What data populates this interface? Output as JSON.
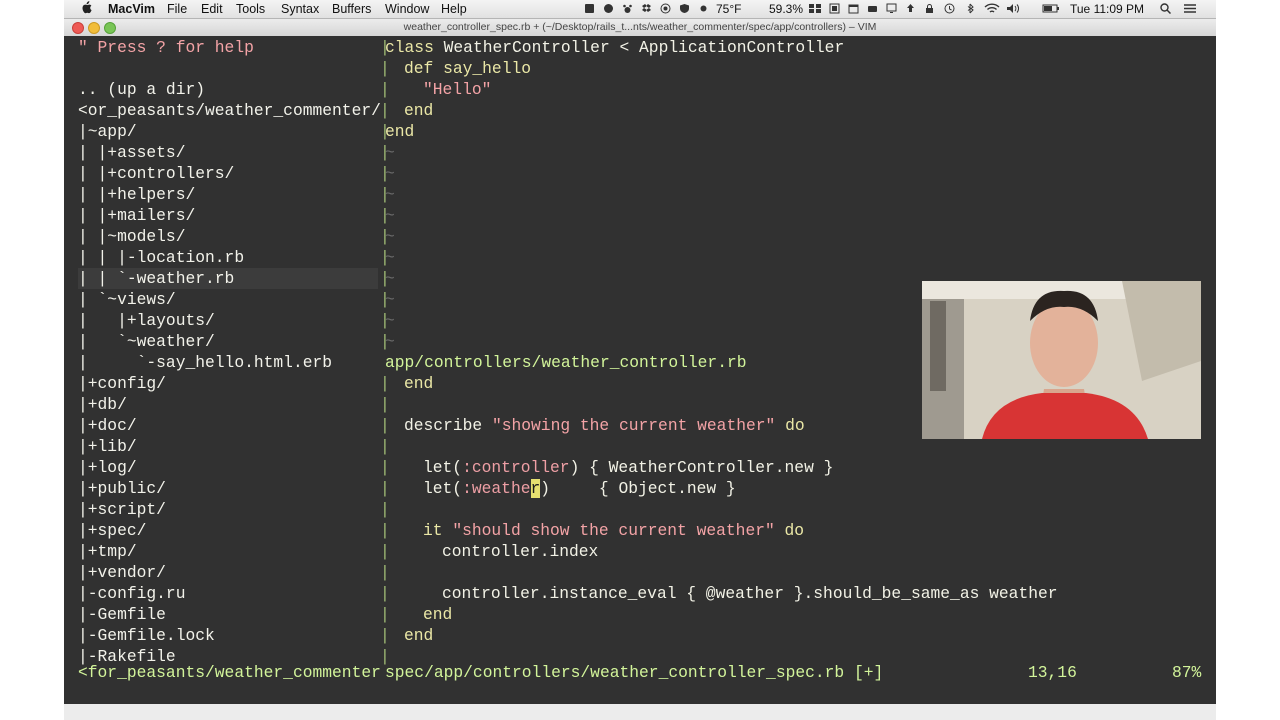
{
  "menubar": {
    "app": "MacVim",
    "items": [
      "File",
      "Edit",
      "Tools",
      "Syntax",
      "Buffers",
      "Window",
      "Help"
    ],
    "status": {
      "weather": "75°F",
      "battery": "59.3%",
      "clock": "Tue 11:09 PM"
    }
  },
  "window": {
    "title": "weather_controller_spec.rb + (~/Desktop/rails_t...nts/weather_commenter/spec/app/controllers) – VIM"
  },
  "tree": {
    "lines": [
      "\" Press ? for help",
      "",
      ".. (up a dir)",
      "<or_peasants/weather_commenter/",
      "|~app/",
      "| |+assets/",
      "| |+controllers/",
      "| |+helpers/",
      "| |+mailers/",
      "| |~models/",
      "| | |-location.rb",
      "| | `-weather.rb",
      "| `~views/",
      "|   |+layouts/",
      "|   `~weather/",
      "|     `-say_hello.html.erb",
      "|+config/",
      "|+db/",
      "|+doc/",
      "|+lib/",
      "|+log/",
      "|+public/",
      "|+script/",
      "|+spec/",
      "|+tmp/",
      "|+vendor/",
      "|-config.ru",
      "|-Gemfile",
      "|-Gemfile.lock",
      "|-Rakefile"
    ]
  },
  "top_pane": {
    "code": {
      "l1_kw": "class",
      "l1_rest": " WeatherController < ApplicationController",
      "l2_kw": "def",
      "l2_rest": " say_hello",
      "l3": "\"Hello\"",
      "l4": "end",
      "l5": "end"
    },
    "tilde": "~",
    "status": "app/controllers/weather_controller.rb"
  },
  "bottom_pane": {
    "code": {
      "l1": "end",
      "l3_kw": "describe",
      "l3_str": "\"showing the current weather\"",
      "l3_do": "do",
      "l5_a": "let(",
      "l5_sym": ":controller",
      "l5_b": ") { WeatherController.new }",
      "l6_a": "let(",
      "l6_sym": ":weathe",
      "l6_cur": "r",
      "l6_b": ")     { Object.new }",
      "l8_kw": "it",
      "l8_str": "\"should show the current weather\"",
      "l8_do": "do",
      "l9": "controller.index",
      "l11": "controller.instance_eval { @weather }.should_be_same_as weather",
      "l12": "end",
      "l13": "end"
    }
  },
  "statusline": {
    "tree": "<for_peasants/weather_commenter",
    "file": "spec/app/controllers/weather_controller_spec.rb [+]",
    "position": "13,16",
    "percent": "87%"
  },
  "colors": {
    "background": "#313131",
    "keyword": "#eae7a6",
    "string": "#f3a3a6",
    "statusline": "#d2f49a",
    "separator": "#a0bb74"
  }
}
